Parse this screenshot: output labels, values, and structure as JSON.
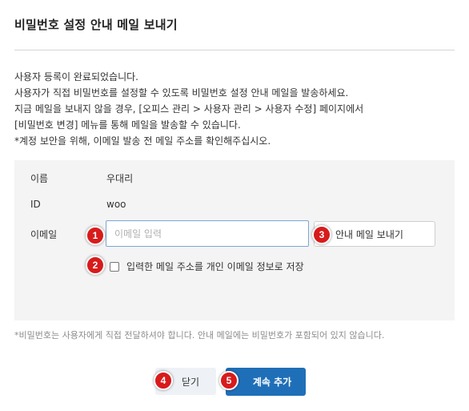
{
  "dialog": {
    "title": "비밀번호 설정 안내 메일 보내기"
  },
  "description": {
    "lines": [
      "사용자 등록이 완료되었습니다.",
      "사용자가 직접 비밀번호를 설정할 수 있도록 비밀번호 설정 안내 메일을 발송하세요.",
      "지금 메일을 보내지 않을 경우, [오피스 관리 > 사용자 관리 > 사용자 수정] 페이지에서",
      "[비밀번호 변경] 메뉴를 통해 메일을 발송할 수 있습니다.",
      "*계정 보안을 위해, 이메일 발송 전 메일 주소를 확인해주십시오."
    ]
  },
  "form": {
    "name_label": "이름",
    "name_value": "우대리",
    "id_label": "ID",
    "id_value": "woo",
    "email_label": "이메일",
    "email_value": "",
    "email_placeholder": "이메일 입력",
    "send_button_label": "안내 메일 보내기",
    "save_checkbox_label": "입력한 메일 주소를 개인 이메일 정보로 저장",
    "save_checked": false
  },
  "footnote": "*비밀번호는 사용자에게 직접 전달하셔야 합니다. 안내 메일에는 비밀번호가 포함되어 있지 않습니다.",
  "footer": {
    "close_label": "닫기",
    "continue_label": "계속 추가"
  },
  "markers": {
    "m1": "1",
    "m2": "2",
    "m3": "3",
    "m4": "4",
    "m5": "5"
  },
  "colors": {
    "primary_button": "#1f6fb8",
    "marker": "#d81b1b",
    "panel_bg": "#f4f4f4"
  }
}
